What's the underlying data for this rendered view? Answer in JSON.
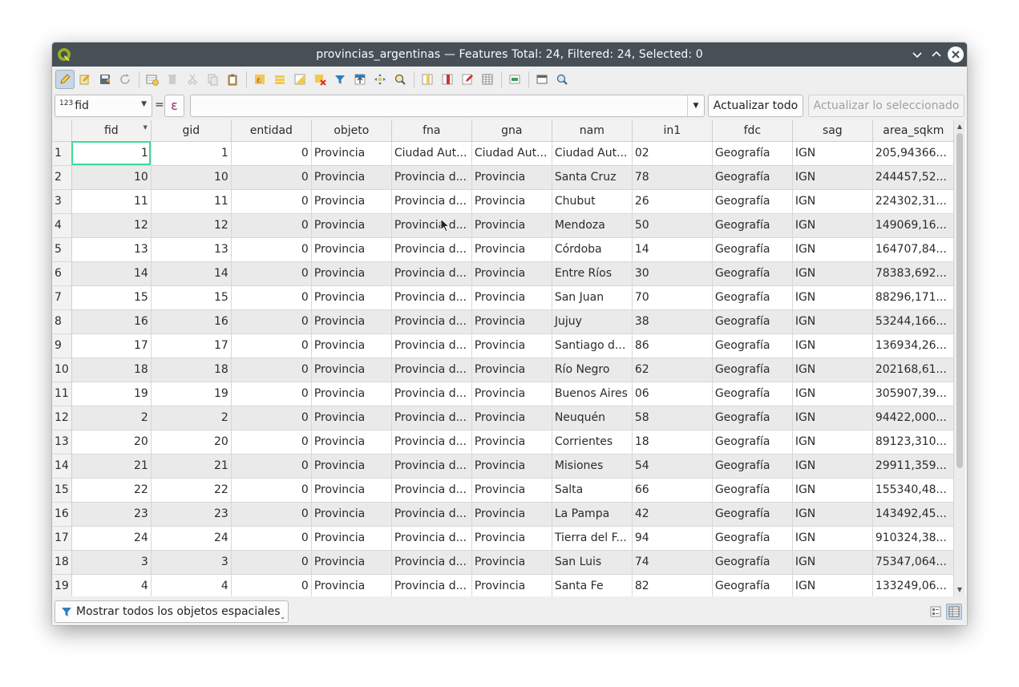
{
  "window": {
    "title": "provincias_argentinas — Features Total: 24, Filtered: 24, Selected: 0"
  },
  "toolbar": {
    "buttons": [
      "toggle-editing",
      "multi-edit",
      "save-edits",
      "reload",
      "add-feature",
      "delete-selected",
      "cut",
      "copy",
      "paste",
      "expression-select",
      "select-all",
      "invert-selection",
      "deselect-all",
      "filter-select",
      "move-selection-top",
      "pan-to-selected",
      "zoom-to-selected",
      "new-field",
      "delete-field",
      "field-calculator",
      "conditional-formatting",
      "actions",
      "dock",
      "organize-columns"
    ]
  },
  "filter": {
    "field_type": "123",
    "field_name": "fid",
    "equals": "=",
    "epsilon": "ε",
    "value": "",
    "update_all": "Actualizar todo",
    "update_selected": "Actualizar lo seleccionado"
  },
  "table": {
    "columns": [
      "fid",
      "gid",
      "entidad",
      "objeto",
      "fna",
      "gna",
      "nam",
      "in1",
      "fdc",
      "sag",
      "area_sqkm"
    ],
    "rows": [
      [
        "1",
        "1",
        "1",
        "0",
        "Provincia",
        "Ciudad Aut...",
        "Ciudad Aut...",
        "Ciudad Aut...",
        "02",
        "Geografía",
        "IGN",
        "205,94366..."
      ],
      [
        "2",
        "10",
        "10",
        "0",
        "Provincia",
        "Provincia d...",
        "Provincia",
        "Santa Cruz",
        "78",
        "Geografía",
        "IGN",
        "244457,52..."
      ],
      [
        "3",
        "11",
        "11",
        "0",
        "Provincia",
        "Provincia d...",
        "Provincia",
        "Chubut",
        "26",
        "Geografía",
        "IGN",
        "224302,31..."
      ],
      [
        "4",
        "12",
        "12",
        "0",
        "Provincia",
        "Provincia d...",
        "Provincia",
        "Mendoza",
        "50",
        "Geografía",
        "IGN",
        "149069,16..."
      ],
      [
        "5",
        "13",
        "13",
        "0",
        "Provincia",
        "Provincia d...",
        "Provincia",
        "Córdoba",
        "14",
        "Geografía",
        "IGN",
        "164707,84..."
      ],
      [
        "6",
        "14",
        "14",
        "0",
        "Provincia",
        "Provincia d...",
        "Provincia",
        "Entre Ríos",
        "30",
        "Geografía",
        "IGN",
        "78383,692..."
      ],
      [
        "7",
        "15",
        "15",
        "0",
        "Provincia",
        "Provincia d...",
        "Provincia",
        "San Juan",
        "70",
        "Geografía",
        "IGN",
        "88296,171..."
      ],
      [
        "8",
        "16",
        "16",
        "0",
        "Provincia",
        "Provincia d...",
        "Provincia",
        "Jujuy",
        "38",
        "Geografía",
        "IGN",
        "53244,166..."
      ],
      [
        "9",
        "17",
        "17",
        "0",
        "Provincia",
        "Provincia d...",
        "Provincia",
        "Santiago d...",
        "86",
        "Geografía",
        "IGN",
        "136934,26..."
      ],
      [
        "10",
        "18",
        "18",
        "0",
        "Provincia",
        "Provincia d...",
        "Provincia",
        "Río Negro",
        "62",
        "Geografía",
        "IGN",
        "202168,61..."
      ],
      [
        "11",
        "19",
        "19",
        "0",
        "Provincia",
        "Provincia d...",
        "Provincia",
        "Buenos Aires",
        "06",
        "Geografía",
        "IGN",
        "305907,39..."
      ],
      [
        "12",
        "2",
        "2",
        "0",
        "Provincia",
        "Provincia d...",
        "Provincia",
        "Neuquén",
        "58",
        "Geografía",
        "IGN",
        "94422,000..."
      ],
      [
        "13",
        "20",
        "20",
        "0",
        "Provincia",
        "Provincia d...",
        "Provincia",
        "Corrientes",
        "18",
        "Geografía",
        "IGN",
        "89123,310..."
      ],
      [
        "14",
        "21",
        "21",
        "0",
        "Provincia",
        "Provincia d...",
        "Provincia",
        "Misiones",
        "54",
        "Geografía",
        "IGN",
        "29911,359..."
      ],
      [
        "15",
        "22",
        "22",
        "0",
        "Provincia",
        "Provincia d...",
        "Provincia",
        "Salta",
        "66",
        "Geografía",
        "IGN",
        "155340,48..."
      ],
      [
        "16",
        "23",
        "23",
        "0",
        "Provincia",
        "Provincia d...",
        "Provincia",
        "La Pampa",
        "42",
        "Geografía",
        "IGN",
        "143492,45..."
      ],
      [
        "17",
        "24",
        "24",
        "0",
        "Provincia",
        "Provincia d...",
        "Provincia",
        "Tierra del F...",
        "94",
        "Geografía",
        "IGN",
        "910324,38..."
      ],
      [
        "18",
        "3",
        "3",
        "0",
        "Provincia",
        "Provincia d...",
        "Provincia",
        "San Luis",
        "74",
        "Geografía",
        "IGN",
        "75347,064..."
      ],
      [
        "19",
        "4",
        "4",
        "0",
        "Provincia",
        "Provincia d...",
        "Provincia",
        "Santa Fe",
        "82",
        "Geografía",
        "IGN",
        "133249,06..."
      ]
    ]
  },
  "bottom": {
    "show_all": "Mostrar todos los objetos espaciales"
  },
  "colors": {
    "titlebar": "#475057",
    "current_cell": "#3ddc97",
    "alt_row": "#eaeaea"
  }
}
